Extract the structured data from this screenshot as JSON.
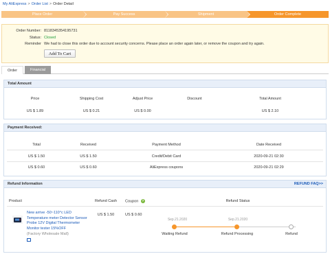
{
  "breadcrumb": {
    "items": [
      "My AliExpress",
      "Order List",
      "Order Detail"
    ],
    "separator": ">"
  },
  "steps": [
    "Place Order",
    "Pay Success",
    "Shipment",
    "Order Complete"
  ],
  "order_info": {
    "number_label": "Order Number:",
    "number_value": "8118345354195731",
    "status_label": "Status:",
    "status_value": "Closed",
    "reminder_label": "Reminder",
    "reminder_value": "We had to close this order due to account security concerns. Please place an order again later, or remove the coupon and try again.",
    "add_to_cart": "Add To Cart"
  },
  "tabs": [
    "Order",
    "Financial"
  ],
  "total_amount": {
    "title": "Total Amount",
    "headers": [
      "Price",
      "Shipping Cost",
      "Adjust Price",
      "Discount",
      "Total Amount"
    ],
    "values": [
      "US $ 1.89",
      "US $ 0.21",
      "US $ 0.00",
      "",
      "US $ 2.10"
    ]
  },
  "payment": {
    "title": "Payment Received:",
    "headers": [
      "Total",
      "Received",
      "Payment Method",
      "Date Received"
    ],
    "rows": [
      [
        "US $ 1.50",
        "US $ 1.50",
        "Credit/Debit Card",
        "2020-09-21 02:30"
      ],
      [
        "US $ 0.60",
        "US $ 0.60",
        "AliExpress coupons",
        "2020-09-21 02:29"
      ]
    ]
  },
  "refund": {
    "title": "Refund Information",
    "faq_link": "REFUND FAQ>>",
    "headers": [
      "Product",
      "Refund Cash",
      "Coupon",
      "Refund Status"
    ],
    "product_title": "New arrive -50~110°c LED Temperature meter Detector Sensor Probe 12V Digital Thermometer Monitor tester 15%OFF",
    "store": "(Factory Wholesale Mall)",
    "refund_cash": "US $ 1.50",
    "coupon": "US $ 0.60",
    "coupon_help": "?",
    "timeline": [
      {
        "date": "Sep.21.2020",
        "label": "Waiting Refund",
        "done": true
      },
      {
        "date": "Sep.21.2020",
        "label": "Refund Processing",
        "done": true
      },
      {
        "date": "",
        "label": "Refund",
        "done": false
      }
    ]
  },
  "colors": {
    "accent": "#f6962b",
    "accent_light": "#f9c485",
    "link": "#1a5ab8",
    "success": "#1e9e3a",
    "panel_header": "#e8eff9"
  },
  "icons": [
    "product-thumbnail-icon",
    "help-icon",
    "message-icon"
  ]
}
